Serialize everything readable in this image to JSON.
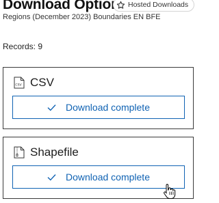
{
  "header": {
    "title": "Download Options",
    "hosted_label": "Hosted Downloads",
    "subtitle": "Regions (December 2023) Boundaries EN BFE"
  },
  "records_label": "Records: 9",
  "cards": [
    {
      "title": "CSV",
      "icon": "csv-file-icon",
      "button_label": "Download complete",
      "button_icon": "checkmark-icon"
    },
    {
      "title": "Shapefile",
      "icon": "zip-file-icon",
      "button_label": "Download complete",
      "button_icon": "checkmark-icon"
    }
  ],
  "colors": {
    "accent": "#0f62b3",
    "card_border": "#3a3a3a",
    "pill_border": "#d4d4d4"
  }
}
